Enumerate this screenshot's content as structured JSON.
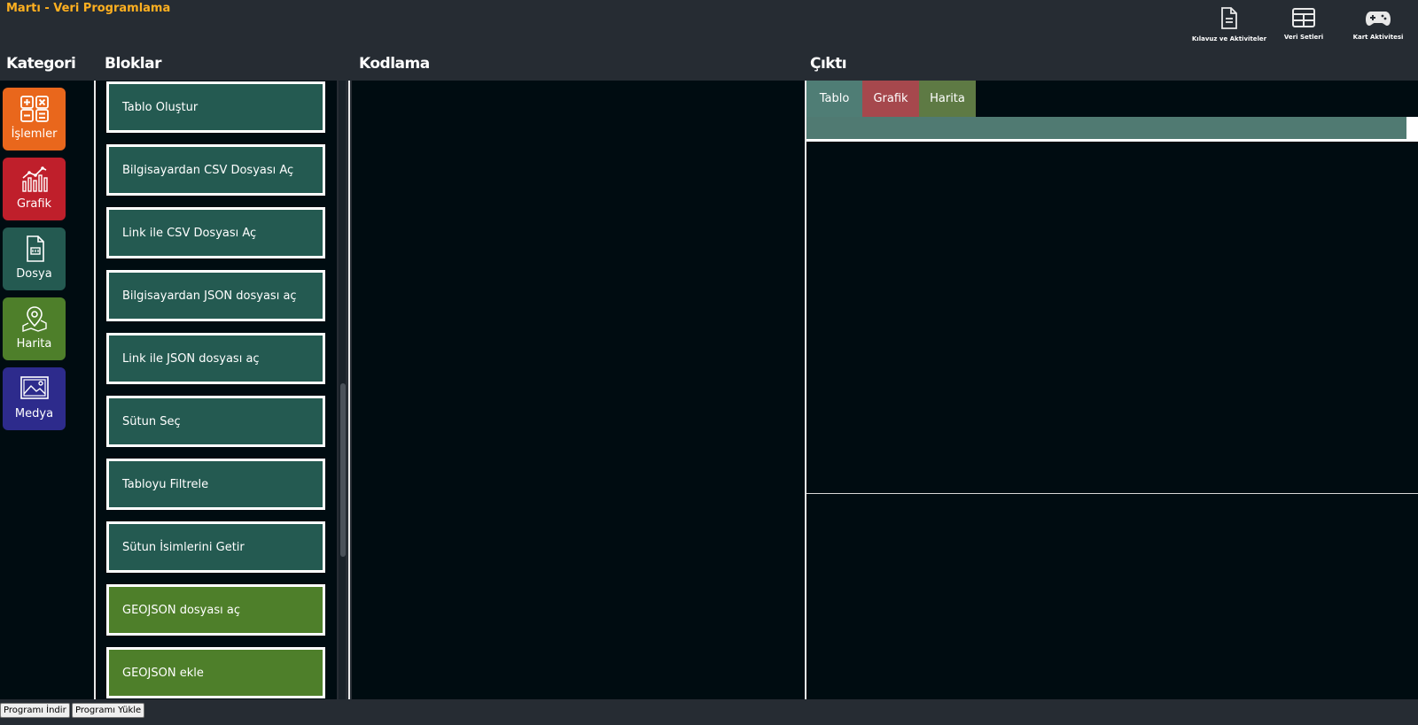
{
  "app": {
    "title": "Martı - Veri Programlama",
    "title_color": "#ffb020"
  },
  "top_actions": [
    {
      "label": "Kılavuz ve Aktiviteler",
      "icon": "document-icon"
    },
    {
      "label": "Veri Setleri",
      "icon": "table-icon"
    },
    {
      "label": "Kart Aktivitesi",
      "icon": "gamepad-icon"
    }
  ],
  "columns": {
    "category": "Kategori",
    "blocks": "Bloklar",
    "coding": "Kodlama",
    "output": "Çıktı"
  },
  "categories": [
    {
      "label": "İşlemler",
      "color": "#e9671c",
      "icon": "calculator-icon"
    },
    {
      "label": "Grafik",
      "color": "#bf1f2b",
      "icon": "chart-icon"
    },
    {
      "label": "Dosya",
      "color": "#245a51",
      "icon": "file-icon"
    },
    {
      "label": "Harita",
      "color": "#4e7f2a",
      "icon": "map-pin-icon"
    },
    {
      "label": "Medya",
      "color": "#2d2b8c",
      "icon": "image-icon"
    }
  ],
  "blocks": [
    {
      "label": "Tablo Oluştur",
      "color": "teal"
    },
    {
      "label": "Bilgisayardan CSV Dosyası Aç",
      "color": "teal"
    },
    {
      "label": "Link ile CSV Dosyası Aç",
      "color": "teal"
    },
    {
      "label": "Bilgisayardan JSON dosyası aç",
      "color": "teal"
    },
    {
      "label": "Link ile JSON dosyası aç",
      "color": "teal"
    },
    {
      "label": "Sütun Seç",
      "color": "teal"
    },
    {
      "label": "Tabloyu Filtrele",
      "color": "teal"
    },
    {
      "label": "Sütun İsimlerini Getir",
      "color": "teal"
    },
    {
      "label": "GEOJSON dosyası aç",
      "color": "green"
    },
    {
      "label": "GEOJSON ekle",
      "color": "green"
    }
  ],
  "output_tabs": [
    {
      "label": "Tablo",
      "color": "#4f7d75"
    },
    {
      "label": "Grafik",
      "color": "#a6484d"
    },
    {
      "label": "Harita",
      "color": "#5e7a44"
    }
  ],
  "bottom_buttons": {
    "download": "Programı İndir",
    "upload": "Programı Yükle"
  }
}
